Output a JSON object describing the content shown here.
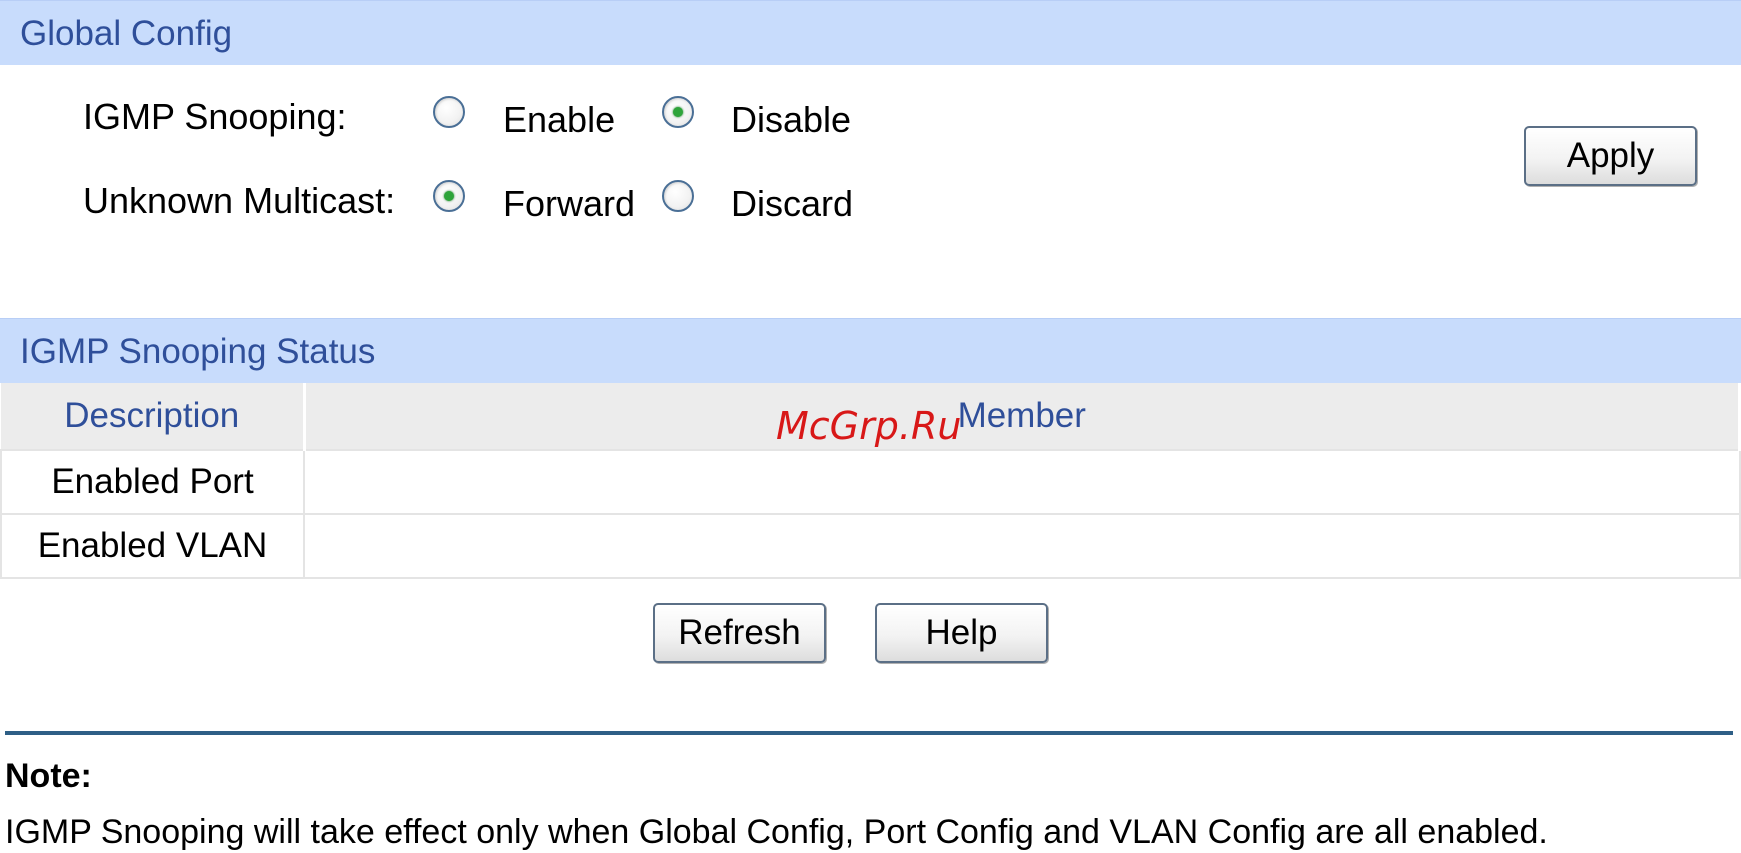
{
  "global_config": {
    "title": "Global Config",
    "igmp_snooping": {
      "label": "IGMP Snooping:",
      "options": [
        {
          "label": "Enable",
          "selected": false
        },
        {
          "label": "Disable",
          "selected": true
        }
      ]
    },
    "unknown_multicast": {
      "label": "Unknown Multicast:",
      "options": [
        {
          "label": "Forward",
          "selected": true
        },
        {
          "label": "Discard",
          "selected": false
        }
      ]
    },
    "apply_label": "Apply"
  },
  "status": {
    "title": "IGMP Snooping Status",
    "columns": [
      "Description",
      "Member"
    ],
    "rows": [
      {
        "description": "Enabled Port",
        "member": ""
      },
      {
        "description": "Enabled VLAN",
        "member": ""
      }
    ],
    "refresh_label": "Refresh",
    "help_label": "Help"
  },
  "note": {
    "heading": "Note:",
    "text": "IGMP Snooping will take effect only when Global Config, Port Config and VLAN Config are all enabled."
  },
  "watermark": "McGrp.Ru",
  "colors": {
    "section_bar": "#c8dcfc",
    "section_title": "#2f4f9a",
    "radio_dot": "#2ea43a",
    "divider": "#2e5f86",
    "watermark": "#d81818"
  }
}
